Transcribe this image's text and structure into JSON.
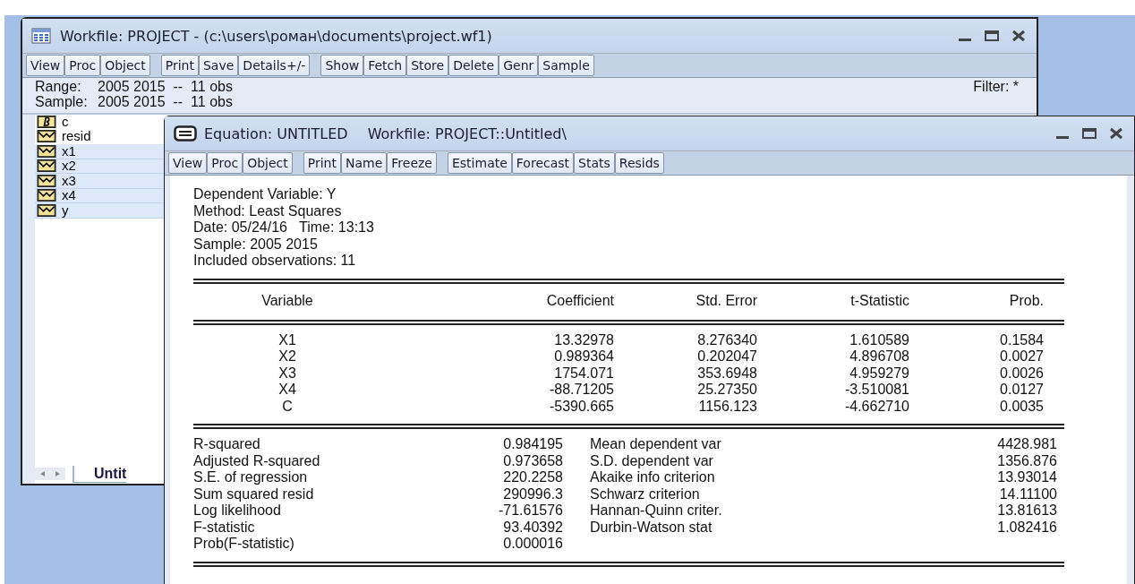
{
  "workfile": {
    "title": "Workfile: PROJECT - (c:\\users\\роман\\documents\\project.wf1)",
    "toolbar": [
      [
        "View",
        "Proc",
        "Object"
      ],
      [
        "Print",
        "Save",
        "Details+/-"
      ],
      [
        "Show",
        "Fetch",
        "Store",
        "Delete",
        "Genr",
        "Sample"
      ]
    ],
    "range": {
      "label": "Range:",
      "value": "2005 2015  --  11 obs"
    },
    "sample": {
      "label": "Sample:",
      "value": "2005 2015  --  11 obs"
    },
    "filter": "Filter: *",
    "objects": [
      {
        "name": "c",
        "kind": "coef",
        "selected": false
      },
      {
        "name": "resid",
        "kind": "series",
        "selected": false
      },
      {
        "name": "x1",
        "kind": "series",
        "selected": true
      },
      {
        "name": "x2",
        "kind": "series",
        "selected": true
      },
      {
        "name": "x3",
        "kind": "series",
        "selected": true
      },
      {
        "name": "x4",
        "kind": "series",
        "selected": true
      },
      {
        "name": "y",
        "kind": "series",
        "selected": true
      }
    ],
    "tab": "Untit"
  },
  "equation": {
    "title": "Equation: UNTITLED",
    "workfile": "Workfile: PROJECT::Untitled\\",
    "toolbar": [
      [
        "View",
        "Proc",
        "Object"
      ],
      [
        "Print",
        "Name",
        "Freeze"
      ],
      [
        "Estimate",
        "Forecast",
        "Stats",
        "Resids"
      ]
    ],
    "header": [
      "Dependent Variable: Y",
      "Method: Least Squares",
      "Date: 05/24/16   Time: 13:13",
      "Sample: 2005 2015",
      "Included observations: 11"
    ],
    "columns": [
      "Variable",
      "Coefficient",
      "Std. Error",
      "t-Statistic",
      "Prob."
    ],
    "rows": [
      [
        "X1",
        "13.32978",
        "8.276340",
        "1.610589",
        "0.1584"
      ],
      [
        "X2",
        "0.989364",
        "0.202047",
        "4.896708",
        "0.0027"
      ],
      [
        "X3",
        "1754.071",
        "353.6948",
        "4.959279",
        "0.0026"
      ],
      [
        "X4",
        "-88.71205",
        "25.27350",
        "-3.510081",
        "0.0127"
      ],
      [
        "C",
        "-5390.665",
        "1156.123",
        "-4.662710",
        "0.0035"
      ]
    ],
    "stats": [
      [
        "R-squared",
        "0.984195",
        "Mean dependent var",
        "4428.981"
      ],
      [
        "Adjusted R-squared",
        "0.973658",
        "S.D. dependent var",
        "1356.876"
      ],
      [
        "S.E. of regression",
        "220.2258",
        "Akaike info criterion",
        "13.93014"
      ],
      [
        "Sum squared resid",
        "290996.3",
        "Schwarz criterion",
        "14.11100"
      ],
      [
        "Log likelihood",
        "-71.61576",
        "Hannan-Quinn criter.",
        "13.81613"
      ],
      [
        "F-statistic",
        "93.40392",
        "Durbin-Watson stat",
        "1.082416"
      ],
      [
        "Prob(F-statistic)",
        "0.000016"
      ]
    ]
  }
}
